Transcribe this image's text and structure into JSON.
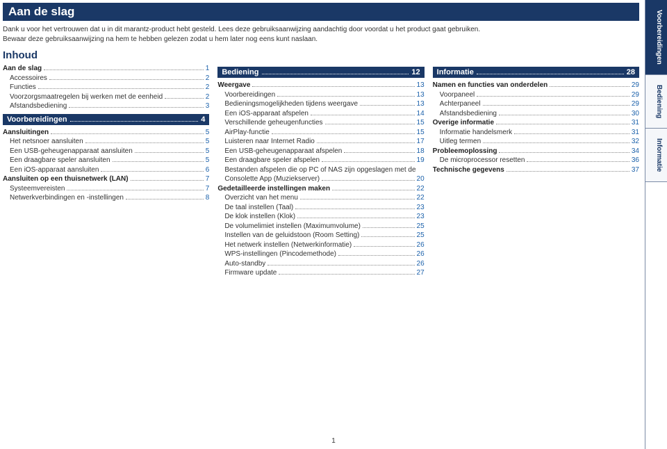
{
  "title": "Aan de slag",
  "intro_line1": "Dank u voor het vertrouwen dat u in dit marantz-product hebt gesteld. Lees deze gebruiksaanwijzing aandachtig door voordat u het product gaat gebruiken.",
  "intro_line2": "Bewaar deze gebruiksaanwijzing na hem te hebben gelezen zodat u hem later nog eens kunt naslaan.",
  "inhoud_heading": "Inhoud",
  "page_number": "1",
  "tabs": [
    {
      "label": "Voorbereidingen",
      "active": true
    },
    {
      "label": "Bediening",
      "active": false
    },
    {
      "label": "Informatie",
      "active": false
    }
  ],
  "col1": {
    "block1": [
      {
        "label": "Aan de slag",
        "page": "1",
        "bold": true
      },
      {
        "label": "Accessoires",
        "page": "2",
        "indent": true
      },
      {
        "label": "Functies",
        "page": "2",
        "indent": true
      },
      {
        "label": "Voorzorgsmaatregelen bij werken met de eenheid",
        "page": "2",
        "indent": true
      },
      {
        "label": "Afstandsbediening",
        "page": "3",
        "indent": true
      }
    ],
    "section": {
      "label": "Voorbereidingen",
      "page": "4"
    },
    "block2": [
      {
        "label": "Aansluitingen",
        "page": "5",
        "bold": true
      },
      {
        "label": "Het netsnoer aansluiten",
        "page": "5",
        "indent": true
      },
      {
        "label": "Een USB-geheugenapparaat aansluiten",
        "page": "5",
        "indent": true
      },
      {
        "label": "Een draagbare speler aansluiten",
        "page": "5",
        "indent": true
      },
      {
        "label": "Een iOS-apparaat aansluiten",
        "page": "6",
        "indent": true
      },
      {
        "label": "Aansluiten op een thuisnetwerk (LAN)",
        "page": "7",
        "bold": true
      },
      {
        "label": "Systeemvereisten",
        "page": "7",
        "indent": true
      },
      {
        "label": "Netwerkverbindingen en -instellingen",
        "page": "8",
        "indent": true
      }
    ]
  },
  "col2": {
    "section": {
      "label": "Bediening",
      "page": "12"
    },
    "block": [
      {
        "label": "Weergave",
        "page": "13",
        "bold": true
      },
      {
        "label": "Voorbereidingen",
        "page": "13",
        "indent": true
      },
      {
        "label": "Bedieningsmogelijkheden tijdens weergave",
        "page": "13",
        "indent": true
      },
      {
        "label": "Een iOS-apparaat afspelen",
        "page": "14",
        "indent": true
      },
      {
        "label": "Verschillende geheugenfuncties",
        "page": "15",
        "indent": true
      },
      {
        "label": "AirPlay-functie",
        "page": "15",
        "indent": true
      },
      {
        "label": "Luisteren naar Internet Radio",
        "page": "17",
        "indent": true
      },
      {
        "label": "Een USB-geheugenapparaat afspelen",
        "page": "18",
        "indent": true
      },
      {
        "label": "Een draagbare speler afspelen",
        "page": "19",
        "indent": true
      },
      {
        "label": "Bestanden afspelen die op PC of NAS zijn opgeslagen met de",
        "indent": true,
        "note": true
      },
      {
        "label": "Consolette App (Muziekserver)",
        "page": "20",
        "indent": true
      },
      {
        "label": "Gedetailleerde instellingen maken",
        "page": "22",
        "bold": true
      },
      {
        "label": "Overzicht van het menu",
        "page": "22",
        "indent": true
      },
      {
        "label": "De taal instellen (Taal)",
        "page": "23",
        "indent": true
      },
      {
        "label": "De klok instellen (Klok)",
        "page": "23",
        "indent": true
      },
      {
        "label": "De volumelimiet instellen (Maximumvolume)",
        "page": "25",
        "indent": true
      },
      {
        "label": "Instellen van de geluidstoon (Room Setting)",
        "page": "25",
        "indent": true
      },
      {
        "label": "Het netwerk instellen (Netwerkinformatie)",
        "page": "26",
        "indent": true
      },
      {
        "label": "WPS-instellingen (Pincodemethode)",
        "page": "26",
        "indent": true
      },
      {
        "label": "Auto-standby",
        "page": "26",
        "indent": true
      },
      {
        "label": "Firmware update",
        "page": "27",
        "indent": true
      }
    ]
  },
  "col3": {
    "section": {
      "label": "Informatie",
      "page": "28"
    },
    "block": [
      {
        "label": "Namen en functies van onderdelen",
        "page": "29",
        "bold": true
      },
      {
        "label": "Voorpaneel",
        "page": "29",
        "indent": true
      },
      {
        "label": "Achterpaneel",
        "page": "29",
        "indent": true
      },
      {
        "label": "Afstandsbediening",
        "page": "30",
        "indent": true
      },
      {
        "label": "Overige informatie",
        "page": "31",
        "bold": true
      },
      {
        "label": "Informatie handelsmerk",
        "page": "31",
        "indent": true
      },
      {
        "label": "Uitleg termen",
        "page": "32",
        "indent": true
      },
      {
        "label": "Probleemoplossing",
        "page": "34",
        "bold": true
      },
      {
        "label": "De microprocessor resetten",
        "page": "36",
        "indent": true
      },
      {
        "label": "Technische gegevens",
        "page": "37",
        "bold": true
      }
    ]
  }
}
